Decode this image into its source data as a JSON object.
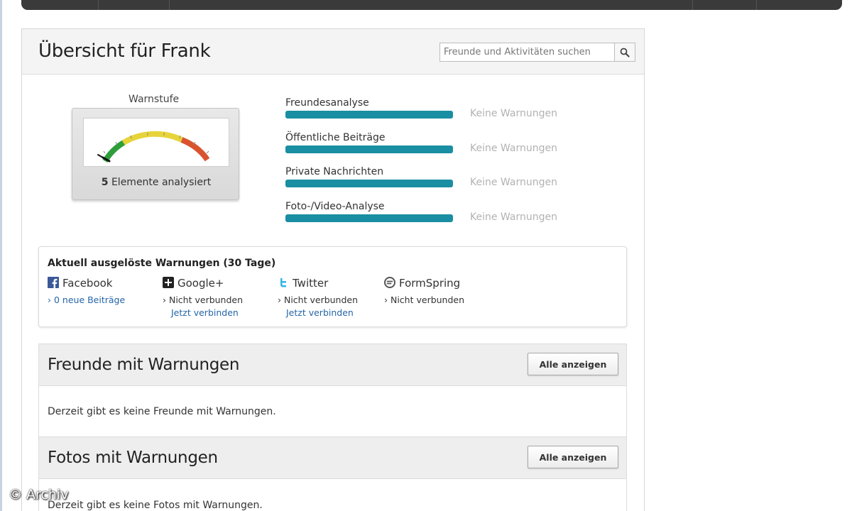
{
  "header": {
    "title": "Übersicht für Frank",
    "search_placeholder": "Freunde und Aktivitäten suchen"
  },
  "gauge": {
    "title": "Warnstufe",
    "analyzed_count": "5",
    "analyzed_label": "Elemente analysiert",
    "colors": [
      "#2e9e3a",
      "#e7d43a",
      "#d9542e"
    ]
  },
  "categories": [
    {
      "label": "Freundesanalyse",
      "status": "Keine Warnungen"
    },
    {
      "label": "Öffentliche Beiträge",
      "status": "Keine Warnungen"
    },
    {
      "label": "Private Nachrichten",
      "status": "Keine Warnungen"
    },
    {
      "label": "Foto-/Video-Analyse",
      "status": "Keine Warnungen"
    }
  ],
  "warnings": {
    "heading": "Aktuell ausgelöste Warnungen (30 Tage)",
    "networks": [
      {
        "name": "Facebook",
        "icon": "facebook-icon",
        "status": "0 neue Beiträge",
        "action": ""
      },
      {
        "name": "Google+",
        "icon": "google-plus-icon",
        "status": "Nicht verbunden",
        "action": "Jetzt verbinden"
      },
      {
        "name": "Twitter",
        "icon": "twitter-icon",
        "status": "Nicht verbunden",
        "action": "Jetzt verbinden"
      },
      {
        "name": "FormSpring",
        "icon": "formspring-icon",
        "status": "Nicht verbunden",
        "action": ""
      }
    ]
  },
  "sections": [
    {
      "title": "Freunde mit Warnungen",
      "button": "Alle anzeigen",
      "empty_text": "Derzeit gibt es keine Freunde mit Warnungen."
    },
    {
      "title": "Fotos mit Warnungen",
      "button": "Alle anzeigen",
      "empty_text": "Derzeit gibt es keine Fotos mit Warnungen."
    }
  ],
  "watermark": "© Archiv",
  "colors": {
    "bar": "#1a8ea2",
    "link": "#2466a8",
    "muted": "#b2b2b2"
  }
}
